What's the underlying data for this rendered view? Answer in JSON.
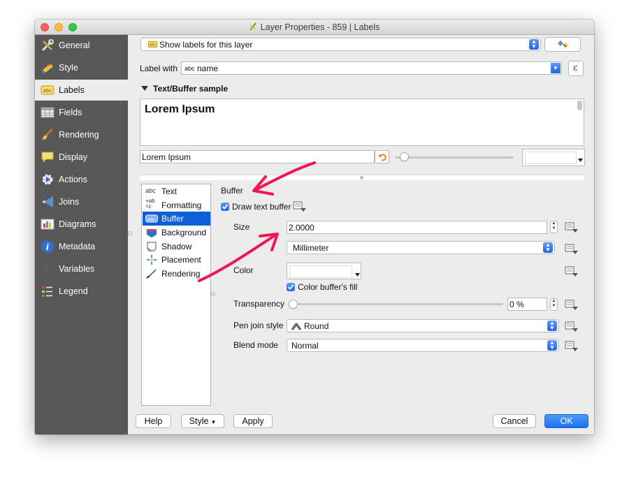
{
  "window": {
    "title": "Layer Properties - 859 | Labels"
  },
  "sidebar": {
    "items": [
      {
        "label": "General",
        "icon": "general-icon"
      },
      {
        "label": "Style",
        "icon": "style-icon"
      },
      {
        "label": "Labels",
        "icon": "labels-icon"
      },
      {
        "label": "Fields",
        "icon": "fields-icon"
      },
      {
        "label": "Rendering",
        "icon": "rendering-icon"
      },
      {
        "label": "Display",
        "icon": "display-icon"
      },
      {
        "label": "Actions",
        "icon": "actions-icon"
      },
      {
        "label": "Joins",
        "icon": "joins-icon"
      },
      {
        "label": "Diagrams",
        "icon": "diagrams-icon"
      },
      {
        "label": "Metadata",
        "icon": "metadata-icon"
      },
      {
        "label": "Variables",
        "icon": "variables-icon"
      },
      {
        "label": "Legend",
        "icon": "legend-icon"
      }
    ],
    "active": "Labels"
  },
  "labels": {
    "mode_value": "Show labels for this layer",
    "label_with_label": "Label with",
    "label_with_value": "name",
    "abc_tag": "abc",
    "expression_symbol": "ε"
  },
  "sample": {
    "header": "Text/Buffer sample",
    "preview_text": "Lorem Ipsum",
    "input_value": "Lorem Ipsum"
  },
  "settings_list": [
    {
      "label": "Text",
      "icon": "text-icon"
    },
    {
      "label": "Formatting",
      "icon": "formatting-icon"
    },
    {
      "label": "Buffer",
      "icon": "buffer-icon"
    },
    {
      "label": "Background",
      "icon": "background-icon"
    },
    {
      "label": "Shadow",
      "icon": "shadow-icon"
    },
    {
      "label": "Placement",
      "icon": "placement-icon"
    },
    {
      "label": "Rendering",
      "icon": "rendering-settings-icon"
    }
  ],
  "buffer": {
    "section_title": "Buffer",
    "draw_buffer_label": "Draw text buffer",
    "draw_buffer_checked": true,
    "size_label": "Size",
    "size_value": "2.0000",
    "unit_value": "Millimeter",
    "color_label": "Color",
    "color_fill_label": "Color buffer's fill",
    "color_fill_checked": true,
    "transparency_label": "Transparency",
    "transparency_value": "0 %",
    "pen_join_label": "Pen join style",
    "pen_join_value": "Round",
    "blend_mode_label": "Blend mode",
    "blend_mode_value": "Normal"
  },
  "footer": {
    "help": "Help",
    "style": "Style",
    "apply": "Apply",
    "cancel": "Cancel",
    "ok": "OK"
  },
  "annotation_color": "#f0164f",
  "accent_color": "#1a6fed"
}
